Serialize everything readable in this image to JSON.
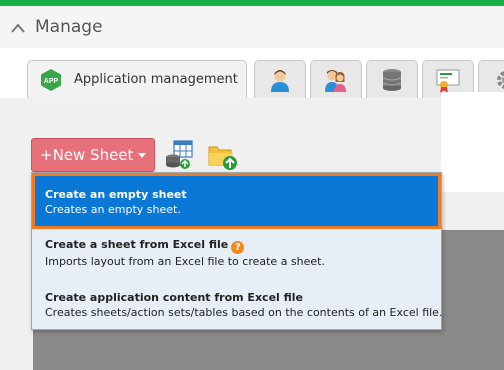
{
  "header": {
    "title": "Manage"
  },
  "tabs": [
    {
      "label": "Application management",
      "badge": "APP",
      "icon": "app-icon"
    },
    {
      "icon": "user-icon"
    },
    {
      "icon": "users-icon"
    },
    {
      "icon": "database-icon"
    },
    {
      "icon": "certificate-icon"
    },
    {
      "icon": "gear-icon"
    }
  ],
  "toolbar": {
    "new_sheet_label": "+New Sheet"
  },
  "menu": {
    "items": [
      {
        "title": "Create an empty sheet",
        "description": "Creates an empty sheet.",
        "selected": true
      },
      {
        "title": "Create a sheet from Excel file",
        "help": "?",
        "description": "Imports layout from an Excel file to create a sheet."
      },
      {
        "title": "Create application content from Excel file",
        "description": "Creates sheets/action sets/tables based on the contents of an Excel file."
      }
    ]
  },
  "colors": {
    "accent_green": "#1ab049",
    "new_sheet_button": "#e8707b",
    "selected_item": "#0a78d6",
    "selected_outline": "#f07a22",
    "help_badge": "#f08a1c"
  }
}
